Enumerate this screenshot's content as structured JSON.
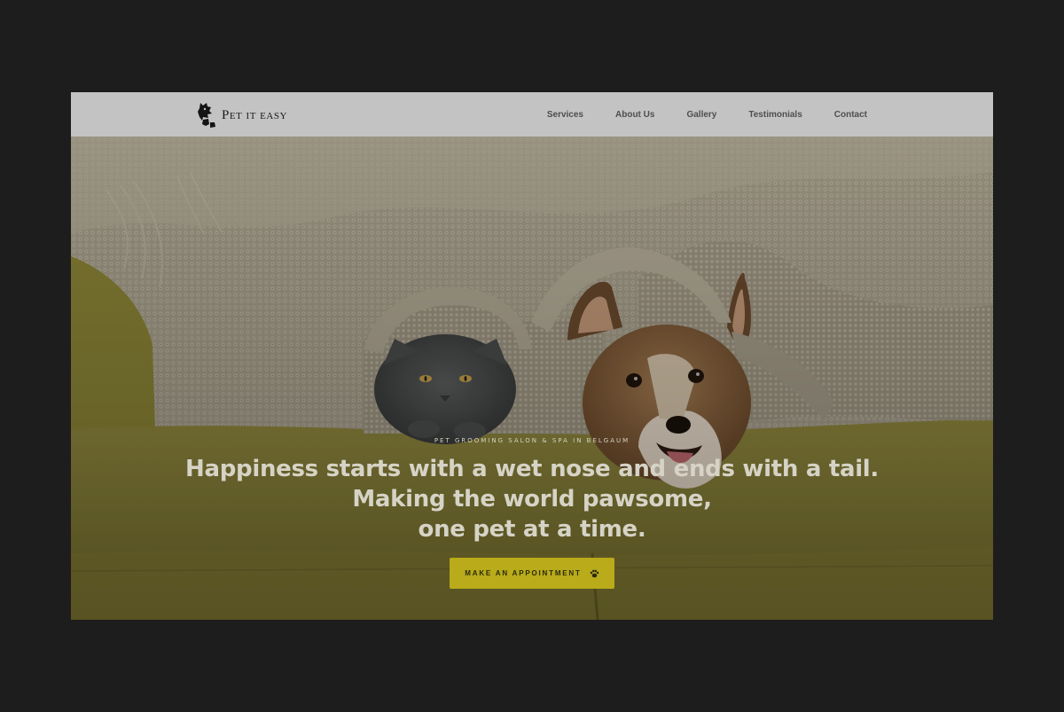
{
  "brand": {
    "name": "Pet it easy"
  },
  "nav": {
    "items": [
      {
        "label": "Services"
      },
      {
        "label": "About Us"
      },
      {
        "label": "Gallery"
      },
      {
        "label": "Testimonials"
      },
      {
        "label": "Contact"
      }
    ]
  },
  "hero": {
    "tagline": "PET GROOMING SALON & SPA IN BELGAUM",
    "headline_lines": [
      "Happiness starts with a wet nose and ends with a tail.",
      "Making the world pawsome,",
      "one pet at a time."
    ],
    "cta_label": "MAKE AN APPOINTMENT",
    "cta_icon": "paw-icon",
    "image_subject": "cat and corgi dog under a knitted blanket on a yellow sofa"
  },
  "colors": {
    "backdrop": "#1d1d1d",
    "navbar": "#c3c3c3",
    "accent": "#b9ab19",
    "sofa": "#8a8232",
    "blanket": "#a9a18f"
  }
}
